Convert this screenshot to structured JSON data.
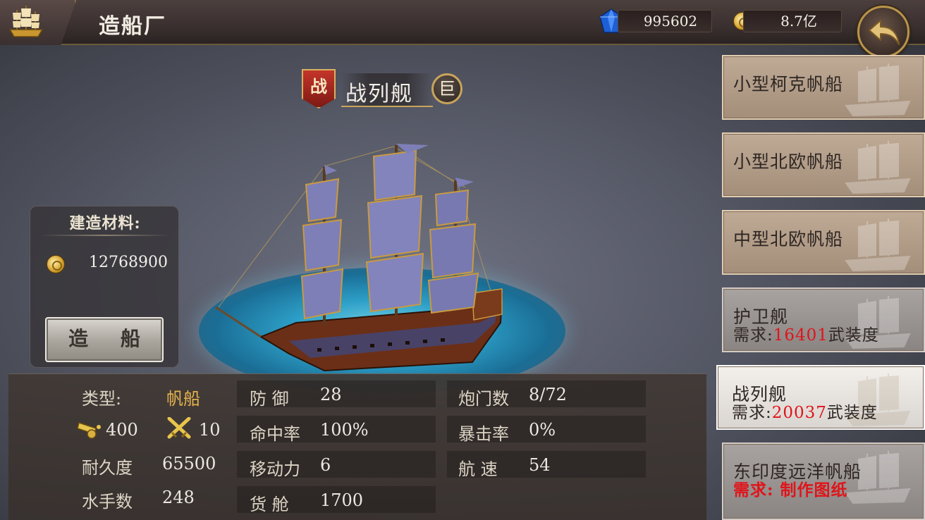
{
  "header": {
    "title": "造船厂",
    "gems": "995602",
    "gold": "8.7亿",
    "icons": [
      "ship-logo-icon",
      "blue-gem-icon",
      "gold-coin-icon",
      "back-arrow-icon"
    ]
  },
  "ship": {
    "badge": "战",
    "name": "战列舰",
    "size_badge": "巨"
  },
  "materials": {
    "title": "建造材料:",
    "gold_cost": "12768900",
    "build_button": "造 船"
  },
  "stats": {
    "type_label": "类型:",
    "type_value": "帆船",
    "cannon_value": "400",
    "crew_attack_value": "10",
    "durability_label": "耐久度",
    "durability_value": "65500",
    "sailors_label": "水手数",
    "sailors_value": "248",
    "defense_label": "防 御",
    "defense_value": "28",
    "accuracy_label": "命中率",
    "accuracy_value": "100%",
    "mobility_label": "移动力",
    "mobility_value": "6",
    "cargo_label": "货 舱",
    "cargo_value": "1700",
    "gunports_label": "炮门数",
    "gunports_value": "8/72",
    "crit_label": "暴击率",
    "crit_value": "0%",
    "speed_label": "航 速",
    "speed_value": "54"
  },
  "ship_list": [
    {
      "name": "小型柯克帆船"
    },
    {
      "name": "小型北欧帆船"
    },
    {
      "name": "中型北欧帆船"
    },
    {
      "name": "护卫舰",
      "req_prefix": "需求:",
      "req_value": "16401",
      "req_suffix": "武装度"
    },
    {
      "name": "战列舰",
      "req_prefix": "需求:",
      "req_value": "20037",
      "req_suffix": "武装度",
      "selected": true
    },
    {
      "name": "东印度远洋帆船",
      "req_text": "需求: 制作图纸"
    }
  ],
  "colors": {
    "accent_gold": "#e8b44c",
    "requirement_red": "#e0141a",
    "topbar": "#3a302f"
  }
}
